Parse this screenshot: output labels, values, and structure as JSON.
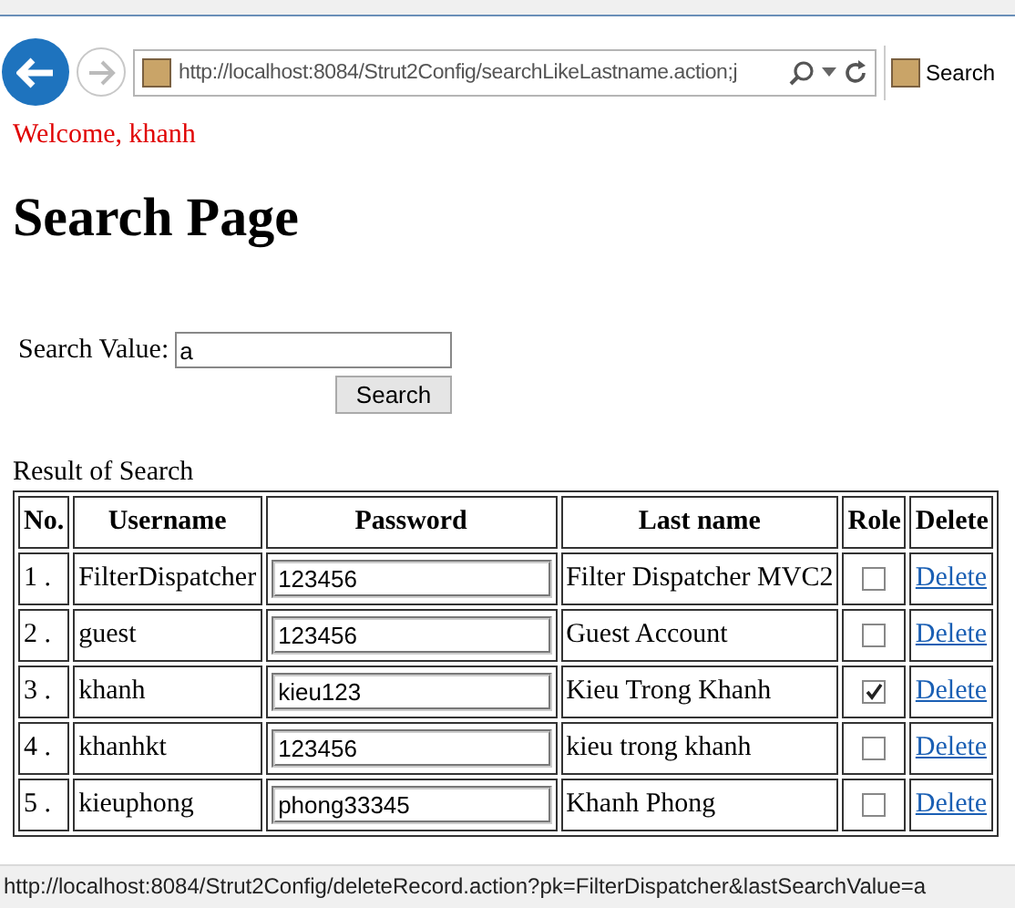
{
  "browser": {
    "address": "http://localhost:8084/Strut2Config/searchLikeLastname.action;j",
    "tab_title": "Search"
  },
  "welcome": "Welcome, khanh",
  "heading": "Search Page",
  "search": {
    "label": "Search Value:",
    "value": "a",
    "button": "Search"
  },
  "result_caption": "Result of Search",
  "table": {
    "columns": [
      "No.",
      "Username",
      "Password",
      "Last name",
      "Role",
      "Delete"
    ],
    "rows": [
      {
        "no": "1 .",
        "username": "FilterDispatcher",
        "password": "123456",
        "last_name": "Filter Dispatcher MVC2",
        "role": false,
        "delete": "Delete"
      },
      {
        "no": "2 .",
        "username": "guest",
        "password": "123456",
        "last_name": "Guest Account",
        "role": false,
        "delete": "Delete"
      },
      {
        "no": "3 .",
        "username": "khanh",
        "password": "kieu123",
        "last_name": "Kieu Trong Khanh",
        "role": true,
        "delete": "Delete"
      },
      {
        "no": "4 .",
        "username": "khanhkt",
        "password": "123456",
        "last_name": "kieu trong khanh",
        "role": false,
        "delete": "Delete"
      },
      {
        "no": "5 .",
        "username": "kieuphong",
        "password": "phong33345",
        "last_name": "Khanh Phong",
        "role": false,
        "delete": "Delete"
      }
    ]
  },
  "status_bar": "http://localhost:8084/Strut2Config/deleteRecord.action?pk=FilterDispatcher&lastSearchValue=a"
}
